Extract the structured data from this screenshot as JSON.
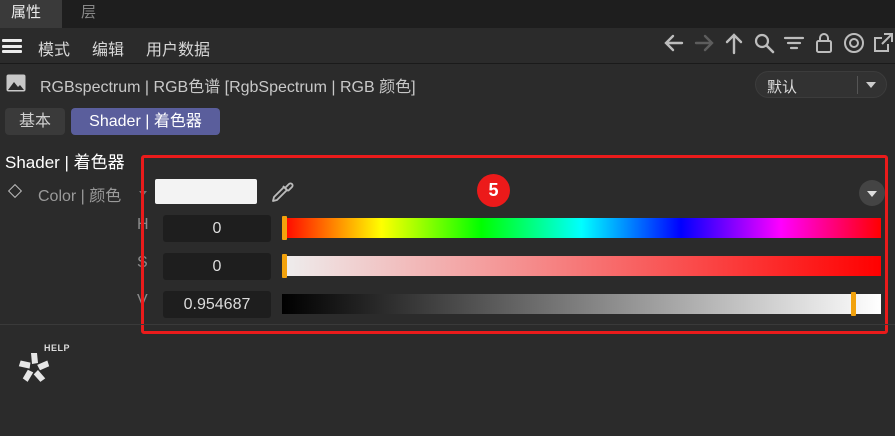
{
  "tabs": [
    {
      "label": "属性",
      "active": true
    },
    {
      "label": "层",
      "active": false
    }
  ],
  "menu": {
    "items": [
      "模式",
      "编辑",
      "用户数据"
    ]
  },
  "toolbar": {
    "icons": [
      "arrow-left-icon",
      "arrow-right-icon",
      "arrow-up-icon",
      "search-icon",
      "filter-icon",
      "lock-icon",
      "target-icon",
      "external-link-icon"
    ]
  },
  "object": {
    "title": "RGBspectrum | RGB色谱 [RgbSpectrum | RGB 颜色]",
    "preset": "默认"
  },
  "subtabs": [
    {
      "label": "基本",
      "active": false
    },
    {
      "label": "Shader | 着色器",
      "active": true
    }
  ],
  "section": {
    "title": "Shader | 着色器"
  },
  "color": {
    "label": "Color | 颜色",
    "swatch": "#f3f3f3"
  },
  "annotation": {
    "badge": "5",
    "highlight_color": "#ea1b1b"
  },
  "hsv": {
    "h": {
      "label": "H",
      "value": "0",
      "fraction": 0.0
    },
    "s": {
      "label": "S",
      "value": "0",
      "fraction": 0.0
    },
    "v": {
      "label": "V",
      "value": "0.954687",
      "fraction": 0.954687
    }
  },
  "help": {
    "label": "HELP"
  },
  "colors": {
    "active_tab_bg": "#5a5e9c",
    "handle": "#f2a20c",
    "panel_bg": "#2b2b2b"
  }
}
